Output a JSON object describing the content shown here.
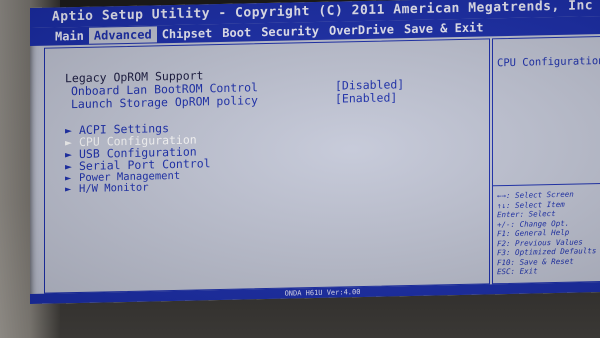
{
  "title": "Aptio Setup Utility - Copyright (C) 2011 American Megatrends, Inc",
  "tabs": [
    {
      "label": "Main",
      "active": false
    },
    {
      "label": "Advanced",
      "active": true
    },
    {
      "label": "Chipset",
      "active": false
    },
    {
      "label": "Boot",
      "active": false
    },
    {
      "label": "Security",
      "active": false
    },
    {
      "label": "OverDrive",
      "active": false
    },
    {
      "label": "Save & Exit",
      "active": false
    }
  ],
  "section_heading": "Legacy OpROM Support",
  "options": [
    {
      "label": "Onboard Lan BootROM Control",
      "value": "[Disabled]"
    },
    {
      "label": "Launch Storage OpROM policy",
      "value": "[Enabled]"
    }
  ],
  "submenus": [
    {
      "label": "ACPI Settings",
      "selected": false
    },
    {
      "label": "CPU Configuration",
      "selected": true
    },
    {
      "label": "USB Configuration",
      "selected": false
    },
    {
      "label": "Serial Port Control",
      "selected": false
    },
    {
      "label": "Power Management",
      "selected": false
    },
    {
      "label": "H/W Monitor",
      "selected": false
    }
  ],
  "help_text": "CPU Configuration",
  "key_help": [
    "←→: Select Screen",
    "↑↓: Select Item",
    "Enter: Select",
    "+/-: Change Opt.",
    "F1: General Help",
    "F2: Previous Values",
    "F3: Optimized Defaults",
    "F10: Save & Reset",
    "ESC: Exit"
  ],
  "footer": "ONDA H61U Ver:4.00",
  "colors": {
    "bios_blue": "#1c2fae",
    "bios_gray": "#c4c8d8",
    "selected_text": "#ffffff"
  }
}
